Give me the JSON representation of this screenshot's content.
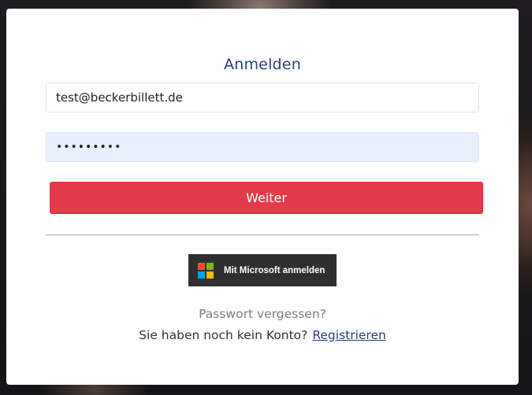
{
  "login": {
    "title": "Anmelden",
    "email_value": "test@beckerbillett.de",
    "password_value": "•••••••••",
    "submit_label": "Weiter",
    "microsoft_label": "Mit Microsoft anmelden",
    "forgot_label": "Passwort vergessen?",
    "no_account_text": "Sie haben noch kein Konto?",
    "register_label": "Registrieren"
  },
  "colors": {
    "primary_button": "#e33b4a",
    "title": "#2b3f73",
    "microsoft_button": "#2f2f2f",
    "ms_red": "#f25022",
    "ms_green": "#7fba00",
    "ms_blue": "#00a4ef",
    "ms_yellow": "#ffb900"
  }
}
